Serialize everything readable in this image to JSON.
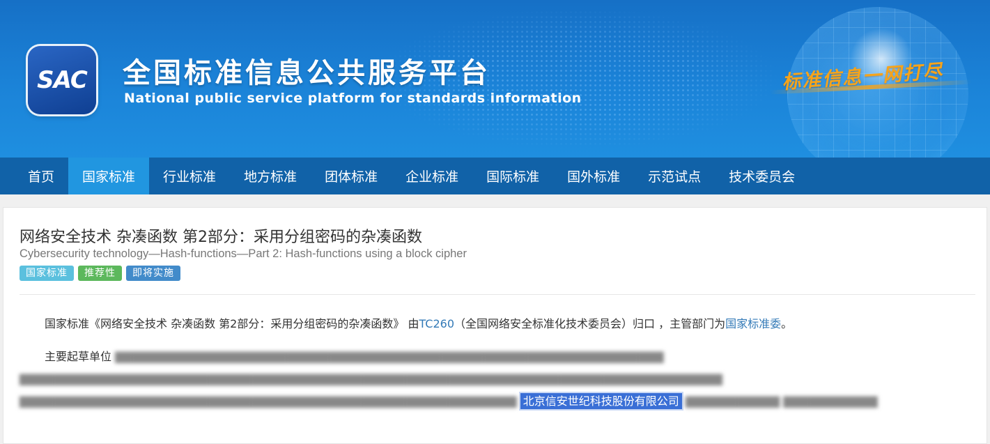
{
  "banner": {
    "logo_text": "SAC",
    "title": "全国标准信息公共服务平台",
    "subtitle": "National public service platform  for standards information",
    "slogan": "标准信息一网打尽"
  },
  "nav": {
    "items": [
      {
        "label": "首页"
      },
      {
        "label": "国家标准"
      },
      {
        "label": "行业标准"
      },
      {
        "label": "地方标准"
      },
      {
        "label": "团体标准"
      },
      {
        "label": "企业标准"
      },
      {
        "label": "国际标准"
      },
      {
        "label": "国外标准"
      },
      {
        "label": "示范试点"
      },
      {
        "label": "技术委员会"
      }
    ],
    "active": "国家标准"
  },
  "standard": {
    "title_cn": "网络安全技术 杂凑函数 第2部分：采用分组密码的杂凑函数",
    "title_en": "Cybersecurity technology—Hash-functions—Part 2: Hash-functions using a block cipher",
    "tags": [
      {
        "label": "国家标准",
        "color": "#5bc0de"
      },
      {
        "label": "推荐性",
        "color": "#5cb85c"
      },
      {
        "label": "即将实施",
        "color": "#428bca"
      }
    ],
    "description": {
      "prefix": "国家标准《网络安全技术 杂凑函数 第2部分：采用分组密码的杂凑函数》 由",
      "tc_link": "TC260",
      "middle": "（全国网络安全标准化技术委员会）归口 ，主管部门为",
      "dept_link": "国家标准委",
      "suffix": "。"
    },
    "drafters": {
      "label": "主要起草单位",
      "highlighted": "北京信安世纪科技股份有限公司"
    }
  },
  "colors": {
    "nav_bg": "#1162a8",
    "nav_active": "#2196e0",
    "link": "#337ab7",
    "highlight": "#3a6fd6"
  }
}
